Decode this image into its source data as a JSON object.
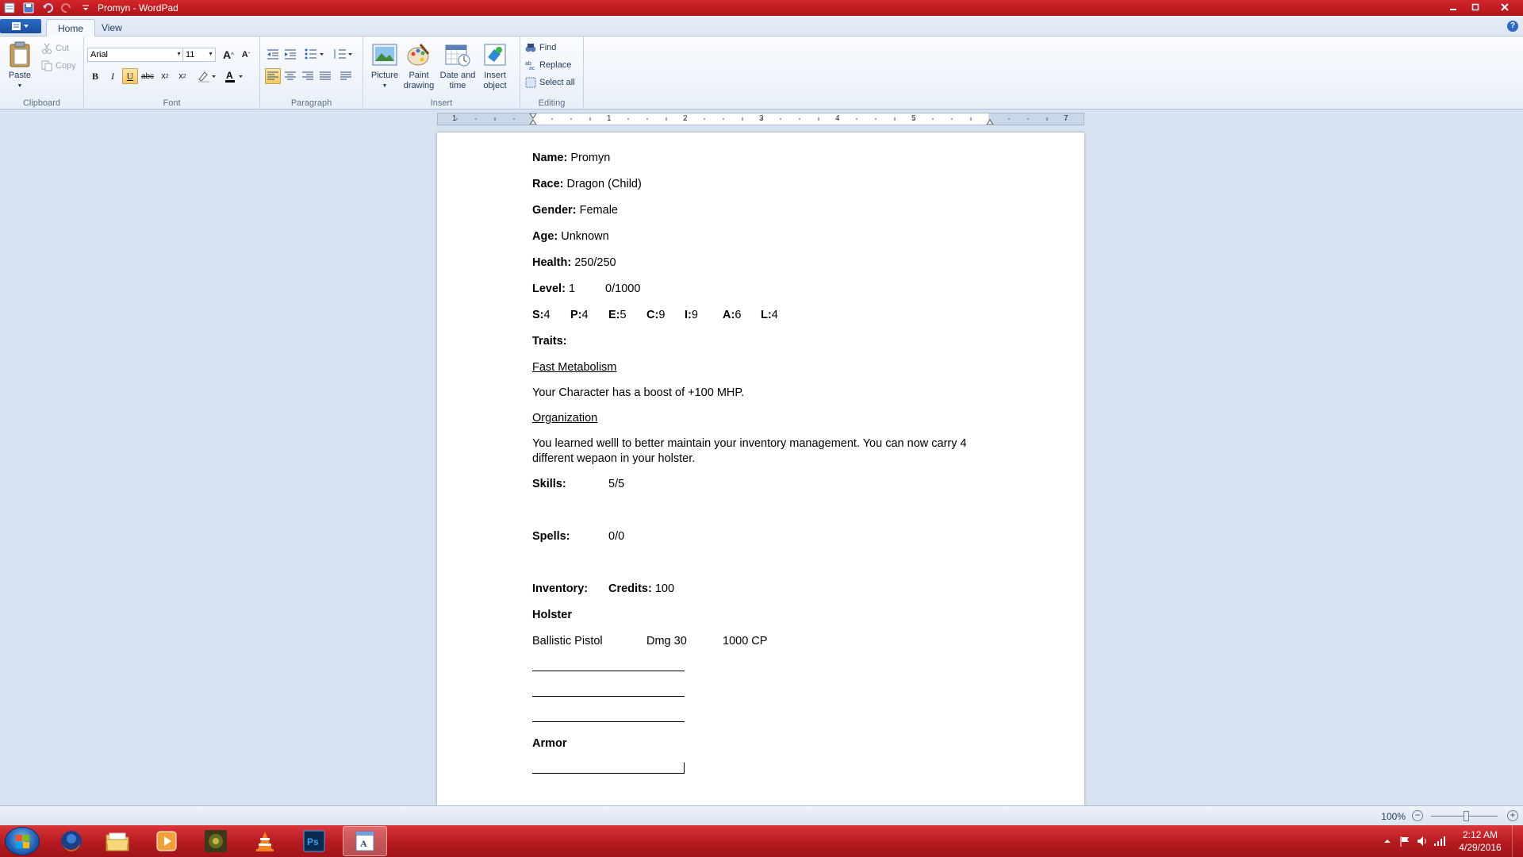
{
  "window": {
    "title": "Promyn - WordPad"
  },
  "tabs": [
    {
      "label": "Home"
    },
    {
      "label": "View"
    }
  ],
  "ribbon": {
    "clipboard": {
      "label": "Clipboard",
      "paste": "Paste",
      "cut": "Cut",
      "copy": "Copy"
    },
    "font": {
      "label": "Font",
      "family": "Arial",
      "size": "11"
    },
    "paragraph": {
      "label": "Paragraph"
    },
    "insert": {
      "label": "Insert",
      "picture": "Picture",
      "paint": "Paint drawing",
      "datetime": "Date and time",
      "object": "Insert object"
    },
    "editing": {
      "label": "Editing",
      "find": "Find",
      "replace": "Replace",
      "select_all": "Select all"
    }
  },
  "ruler": {
    "numbers": [
      "1",
      "1",
      "2",
      "3",
      "4",
      "5",
      "7"
    ]
  },
  "document": {
    "name_label": "Name:",
    "name": "Promyn",
    "race_label": "Race:",
    "race": "Dragon (Child)",
    "gender_label": "Gender:",
    "gender": "Female",
    "age_label": "Age:",
    "age": "Unknown",
    "health_label": "Health:",
    "health": "250/250",
    "level_label": "Level:",
    "level": "1",
    "xp": "0/1000",
    "stats": [
      {
        "k": "S:",
        "v": "4"
      },
      {
        "k": "P:",
        "v": "4"
      },
      {
        "k": "E:",
        "v": "5"
      },
      {
        "k": "C:",
        "v": "9"
      },
      {
        "k": "I:",
        "v": "9"
      },
      {
        "k": "A:",
        "v": "6"
      },
      {
        "k": "L:",
        "v": "4"
      }
    ],
    "traits_label": "Traits:",
    "trait1_name": "Fast Metabolism",
    "trait1_desc": "Your Character has a boost of +100 MHP.",
    "trait2_name": "Organization",
    "trait2_desc_line1": "You learned welll to better maintain your inventory management. You can now carry 4",
    "trait2_desc_line2": "different wepaon in your holster.",
    "skills_label": "Skills:",
    "skills": "5/5",
    "spells_label": "Spells:",
    "spells": "0/0",
    "inventory_label": "Inventory:",
    "credits_label": "Credits:",
    "credits": "100",
    "holster_label": "Holster",
    "weapon_name": "Ballistic Pistol",
    "weapon_dmg": "Dmg 30",
    "weapon_cost": "1000 CP",
    "armor_label": "Armor"
  },
  "statusbar": {
    "zoom": "100%"
  },
  "taskbar": {
    "time": "2:12 AM",
    "date": "4/29/2016"
  },
  "colors": {
    "titlebar": "#c41e23",
    "taskbar": "#b51a1f",
    "ribbon": "#e8eff8",
    "workspace": "#d7e3f1"
  }
}
